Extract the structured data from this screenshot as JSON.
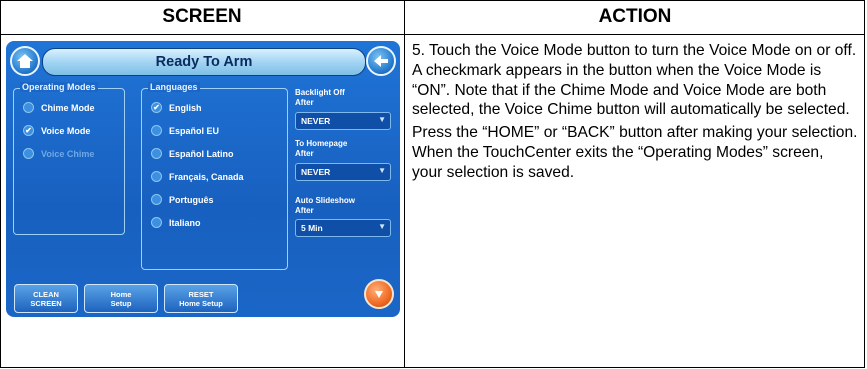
{
  "table": {
    "col_screen": "SCREEN",
    "col_action": "ACTION"
  },
  "device": {
    "title": "Ready To Arm",
    "operating_modes": {
      "label": "Operating Modes",
      "items": [
        {
          "label": "Chime Mode",
          "checked": false
        },
        {
          "label": "Voice Mode",
          "checked": true
        },
        {
          "label": "Voice Chime",
          "checked": false
        }
      ]
    },
    "languages": {
      "label": "Languages",
      "items": [
        {
          "label": "English",
          "checked": true
        },
        {
          "label": "Español EU",
          "checked": false
        },
        {
          "label": "Español Latino",
          "checked": false
        },
        {
          "label": "Français, Canada",
          "checked": false
        },
        {
          "label": "Português",
          "checked": false
        },
        {
          "label": "Italiano",
          "checked": false
        }
      ]
    },
    "backlight": {
      "label_line1": "Backlight Off",
      "label_line2": "After",
      "value": "NEVER"
    },
    "homepage": {
      "label_line1": "To Homepage",
      "label_line2": "After",
      "value": "NEVER"
    },
    "slideshow": {
      "label_line1": "Auto Slideshow",
      "label_line2": "After",
      "value": "5 Min"
    },
    "buttons": {
      "clean_line1": "CLEAN",
      "clean_line2": "SCREEN",
      "home_setup_line1": "Home",
      "home_setup_line2": "Setup",
      "reset_line1": "RESET",
      "reset_line2": "Home Setup"
    },
    "icons": {
      "home": "home-icon",
      "back": "back-arrow-icon",
      "next": "next-arrow-icon",
      "check": "check-icon",
      "dropdown": "chevron-down-icon"
    }
  },
  "action": {
    "paragraph1": "5. Touch the Voice Mode button to turn the Voice Mode on or off. A checkmark appears in the button when the Voice Mode is “ON”.  Note that if the Chime Mode and Voice Mode are both selected, the Voice Chime button will automatically be selected.",
    "paragraph2": "Press the “HOME” or “BACK” button after making your selection. When the TouchCenter exits the “Operating Modes” screen, your selection is saved."
  }
}
